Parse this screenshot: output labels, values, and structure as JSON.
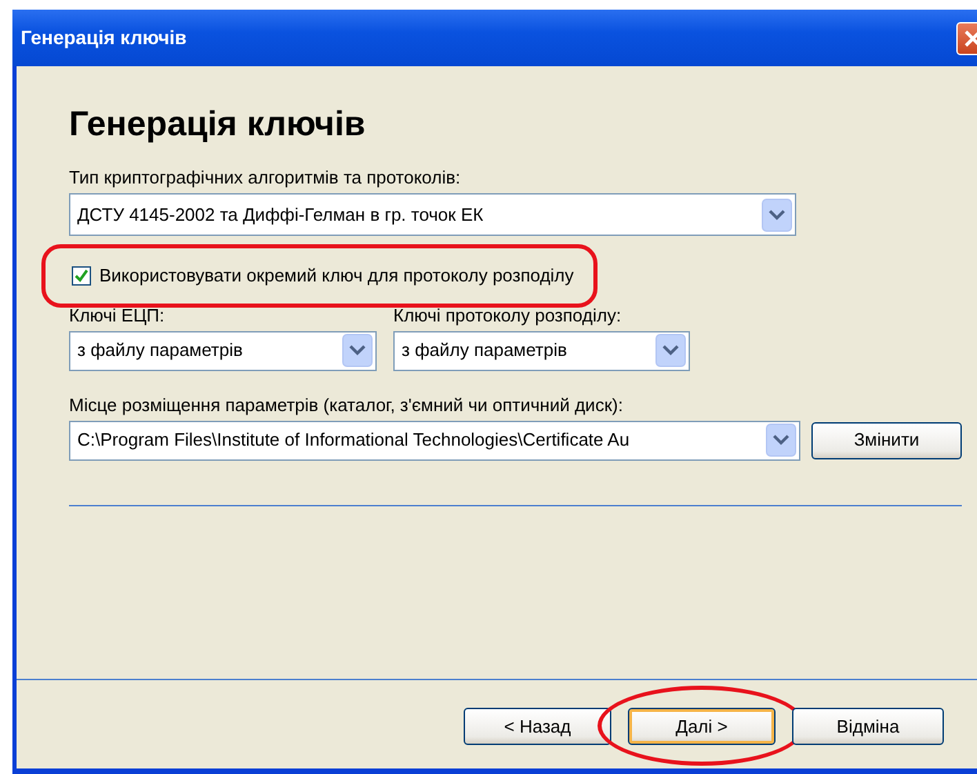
{
  "window": {
    "title": "Генерація ключів"
  },
  "heading": "Генерація ключів",
  "algorithm": {
    "label": "Тип криптографічних алгоритмів та протоколів:",
    "value": "ДСТУ 4145-2002 та Диффі-Гелман в гр. точок ЕК"
  },
  "separate_key": {
    "label": "Використовувати окремий ключ для протоколу розподілу",
    "checked": true,
    "annotated": true
  },
  "signature_keys": {
    "label": "Ключі ЕЦП:",
    "value": "з файлу параметрів"
  },
  "exchange_keys": {
    "label": "Ключі протоколу розподілу:",
    "value": "з файлу параметрів"
  },
  "location": {
    "label": "Місце розміщення параметрів (каталог, з'ємний чи оптичний диск):",
    "value": "C:\\Program Files\\Institute of Informational Technologies\\Certificate Au",
    "button": "Змінити"
  },
  "buttons": [
    {
      "label": "< Назад",
      "default": false,
      "annotated": false
    },
    {
      "label": "Далі >",
      "default": true,
      "annotated": true
    },
    {
      "label": "Відміна",
      "default": false,
      "annotated": false
    }
  ]
}
